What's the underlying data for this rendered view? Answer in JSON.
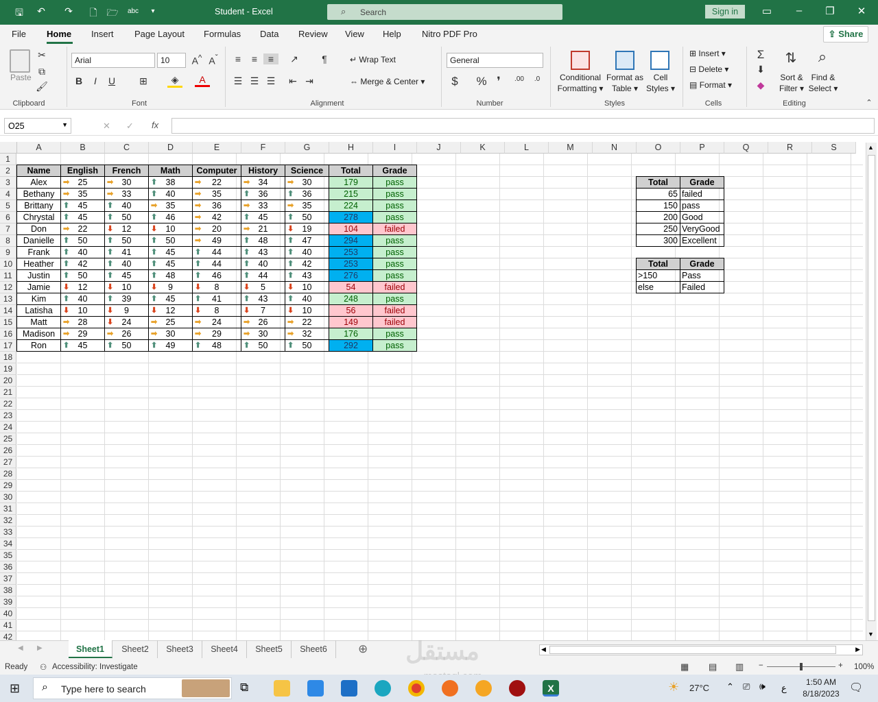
{
  "titlebar": {
    "title": "Student  -  Excel",
    "search_placeholder": "Search",
    "signin": "Sign in"
  },
  "menu": {
    "file": "File",
    "home": "Home",
    "insert": "Insert",
    "page_layout": "Page Layout",
    "formulas": "Formulas",
    "data": "Data",
    "review": "Review",
    "view": "View",
    "help": "Help",
    "nitro": "Nitro PDF Pro",
    "share": "Share"
  },
  "ribbon": {
    "clipboard": {
      "paste": "Paste",
      "label": "Clipboard"
    },
    "font": {
      "name": "Arial",
      "size": "10",
      "label": "Font",
      "bold": "B",
      "italic": "I",
      "underline": "U"
    },
    "alignment": {
      "wrap": "Wrap Text",
      "merge": "Merge & Center",
      "label": "Alignment"
    },
    "number": {
      "format": "General",
      "label": "Number"
    },
    "styles": {
      "cond1": "Conditional",
      "cond2": "Formatting",
      "fmt1": "Format as",
      "fmt2": "Table",
      "cell1": "Cell",
      "cell2": "Styles",
      "label": "Styles"
    },
    "cells": {
      "insert": "Insert",
      "delete": "Delete",
      "format": "Format",
      "label": "Cells"
    },
    "editing": {
      "sort1": "Sort &",
      "sort2": "Filter",
      "find1": "Find &",
      "find2": "Select",
      "label": "Editing"
    }
  },
  "formula_bar": {
    "name_box": "O25",
    "formula": ""
  },
  "columns": [
    "A",
    "B",
    "C",
    "D",
    "E",
    "F",
    "G",
    "H",
    "I",
    "J",
    "K",
    "L",
    "M",
    "N",
    "O",
    "P",
    "Q",
    "R",
    "S"
  ],
  "rows": [
    "1",
    "2",
    "3",
    "4",
    "5",
    "6",
    "7",
    "8",
    "9",
    "10",
    "11",
    "12",
    "13",
    "14",
    "15",
    "16",
    "17",
    "18",
    "19",
    "20",
    "21",
    "22",
    "23",
    "24",
    "25",
    "26",
    "27",
    "28",
    "29",
    "30",
    "31",
    "32",
    "33",
    "34",
    "35",
    "36",
    "37",
    "38",
    "39",
    "40",
    "41",
    "42"
  ],
  "table": {
    "headers": [
      "Name",
      "English",
      "French",
      "Math",
      "Computer",
      "History",
      "Science",
      "Total",
      "Grade"
    ],
    "students": [
      {
        "name": "Alex",
        "scores": [
          25,
          30,
          38,
          22,
          34,
          30
        ],
        "icons": [
          "side",
          "side",
          "up",
          "side",
          "side",
          "side"
        ],
        "total": 179,
        "grade": "pass",
        "band": "green"
      },
      {
        "name": "Bethany",
        "scores": [
          35,
          33,
          40,
          35,
          36,
          36
        ],
        "icons": [
          "side",
          "side",
          "up",
          "side",
          "up",
          "up"
        ],
        "total": 215,
        "grade": "pass",
        "band": "green"
      },
      {
        "name": "Brittany",
        "scores": [
          45,
          40,
          35,
          36,
          33,
          35
        ],
        "icons": [
          "up",
          "up",
          "side",
          "side",
          "side",
          "side"
        ],
        "total": 224,
        "grade": "pass",
        "band": "green"
      },
      {
        "name": "Chrystal",
        "scores": [
          45,
          50,
          46,
          42,
          45,
          50
        ],
        "icons": [
          "up",
          "up",
          "up",
          "side",
          "up",
          "up"
        ],
        "total": 278,
        "grade": "pass",
        "band": "blue"
      },
      {
        "name": "Don",
        "scores": [
          22,
          12,
          10,
          20,
          21,
          19
        ],
        "icons": [
          "side",
          "down",
          "down",
          "side",
          "side",
          "down"
        ],
        "total": 104,
        "grade": "failed",
        "band": "red"
      },
      {
        "name": "Danielle",
        "scores": [
          50,
          50,
          50,
          49,
          48,
          47
        ],
        "icons": [
          "up",
          "up",
          "up",
          "side",
          "up",
          "up"
        ],
        "total": 294,
        "grade": "pass",
        "band": "blue"
      },
      {
        "name": "Frank",
        "scores": [
          40,
          41,
          45,
          44,
          43,
          40
        ],
        "icons": [
          "up",
          "up",
          "up",
          "up",
          "up",
          "up"
        ],
        "total": 253,
        "grade": "pass",
        "band": "blue"
      },
      {
        "name": "Heather",
        "scores": [
          42,
          40,
          45,
          44,
          40,
          42
        ],
        "icons": [
          "up",
          "up",
          "up",
          "up",
          "up",
          "up"
        ],
        "total": 253,
        "grade": "pass",
        "band": "blue"
      },
      {
        "name": "Justin",
        "scores": [
          50,
          45,
          48,
          46,
          44,
          43
        ],
        "icons": [
          "up",
          "up",
          "up",
          "up",
          "up",
          "up"
        ],
        "total": 276,
        "grade": "pass",
        "band": "blue"
      },
      {
        "name": "Jamie",
        "scores": [
          12,
          10,
          9,
          8,
          5,
          10
        ],
        "icons": [
          "down",
          "down",
          "down",
          "down",
          "down",
          "down"
        ],
        "total": 54,
        "grade": "failed",
        "band": "red"
      },
      {
        "name": "Kim",
        "scores": [
          40,
          39,
          45,
          41,
          43,
          40
        ],
        "icons": [
          "up",
          "up",
          "up",
          "up",
          "up",
          "up"
        ],
        "total": 248,
        "grade": "pass",
        "band": "green"
      },
      {
        "name": "Latisha",
        "scores": [
          10,
          9,
          12,
          8,
          7,
          10
        ],
        "icons": [
          "down",
          "down",
          "down",
          "down",
          "down",
          "down"
        ],
        "total": 56,
        "grade": "failed",
        "band": "red"
      },
      {
        "name": "Matt",
        "scores": [
          28,
          24,
          25,
          24,
          26,
          22
        ],
        "icons": [
          "side",
          "down",
          "side",
          "side",
          "side",
          "side"
        ],
        "total": 149,
        "grade": "failed",
        "band": "red"
      },
      {
        "name": "Madison",
        "scores": [
          29,
          26,
          30,
          29,
          30,
          32
        ],
        "icons": [
          "side",
          "side",
          "side",
          "side",
          "side",
          "side"
        ],
        "total": 176,
        "grade": "pass",
        "band": "green"
      },
      {
        "name": "Ron",
        "scores": [
          45,
          50,
          49,
          48,
          50,
          50
        ],
        "icons": [
          "up",
          "up",
          "up",
          "up",
          "up",
          "up"
        ],
        "total": 292,
        "grade": "pass",
        "band": "blue"
      }
    ]
  },
  "lookup1": {
    "headers": [
      "Total",
      "Grade"
    ],
    "rows": [
      [
        "65",
        "failed"
      ],
      [
        "150",
        "pass"
      ],
      [
        "200",
        "Good"
      ],
      [
        "250",
        "VeryGood"
      ],
      [
        "300",
        "Excellent"
      ]
    ]
  },
  "lookup2": {
    "headers": [
      "Total",
      "Grade"
    ],
    "rows": [
      [
        ">150",
        "Pass"
      ],
      [
        "else",
        "Failed"
      ]
    ]
  },
  "sheets": [
    "Sheet1",
    "Sheet2",
    "Sheet3",
    "Sheet4",
    "Sheet5",
    "Sheet6"
  ],
  "status": {
    "ready": "Ready",
    "accessibility": "Accessibility: Investigate",
    "zoom": "100%"
  },
  "taskbar": {
    "search": "Type here to search",
    "weather": "27°C",
    "time": "1:50 AM",
    "date": "8/18/2023",
    "lang": "ع"
  },
  "watermark": {
    "arabic": "مستقل",
    "latin": "mostaql.com"
  },
  "colors": {
    "excel_green": "#217346",
    "pass_fill": "#c6efce",
    "high_fill": "#00b0f0",
    "fail_fill": "#ffc7ce",
    "arrow_up": "#4f8f7a",
    "arrow_down": "#d9431c",
    "arrow_side": "#e8a22b"
  }
}
